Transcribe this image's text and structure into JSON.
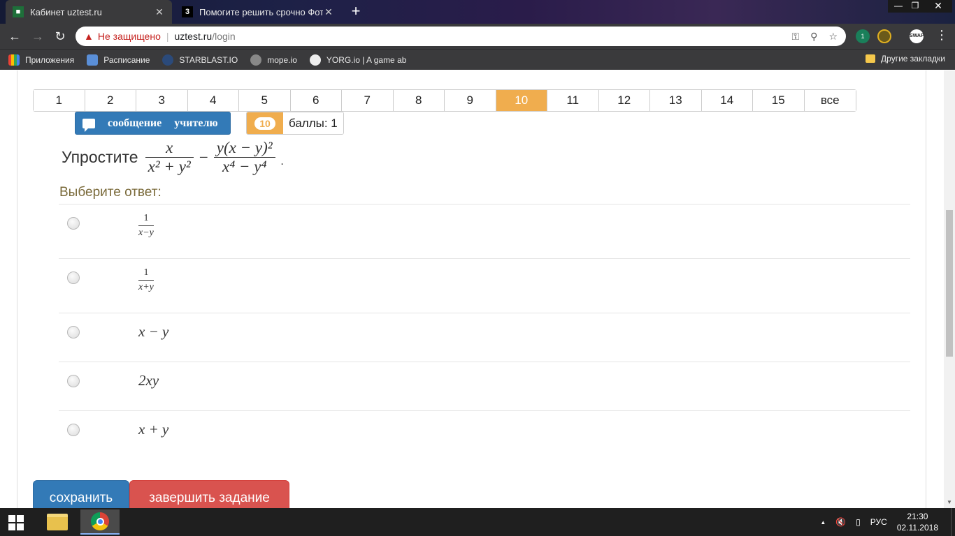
{
  "browser": {
    "tabs": [
      {
        "title": "Кабинет uztest.ru",
        "close": "✕",
        "active": true
      },
      {
        "title": "Помогите решить срочно Фото",
        "close": "✕",
        "active": false
      }
    ],
    "new_tab": "+",
    "window": {
      "minimize": "—",
      "maximize": "❐",
      "close": "✕"
    },
    "nav": {
      "back": "←",
      "forward": "→",
      "reload": "↻"
    },
    "address": {
      "warning_icon": "▲",
      "security_text": "Не защищено",
      "separator": "|",
      "host": "uztest.ru",
      "path": "/login"
    },
    "omnibox_icons": {
      "key": "⚿",
      "zoom": "⚲",
      "star": "☆"
    },
    "extensions": {
      "badge_count": "1",
      "swap": "SWAP"
    },
    "menu": "⋮",
    "bookmarks": [
      {
        "label": "Приложения"
      },
      {
        "label": "Расписание"
      },
      {
        "label": "STARBLAST.IO"
      },
      {
        "label": "mope.io"
      },
      {
        "label": "YORG.io | A game ab"
      }
    ],
    "other_bookmarks": "Другие закладки"
  },
  "page": {
    "question_nav": [
      "1",
      "2",
      "3",
      "4",
      "5",
      "6",
      "7",
      "8",
      "9",
      "10",
      "11",
      "12",
      "13",
      "14",
      "15",
      "все"
    ],
    "active_question": "10",
    "message_button": "сообщение учителю",
    "score": {
      "number": "10",
      "label": "баллы: 1"
    },
    "question": {
      "lead": "Упростите",
      "f1_num": "x",
      "f1_den": "x² + y²",
      "minus": "−",
      "f2_num": "y(x − y)²",
      "f2_den": "x⁴ − y⁴",
      "end": "."
    },
    "choose_label": "Выберите ответ:",
    "answers": [
      {
        "type": "frac",
        "num": "1",
        "den": "x−y"
      },
      {
        "type": "frac",
        "num": "1",
        "den": "x+y"
      },
      {
        "type": "expr",
        "text": "x − y"
      },
      {
        "type": "expr",
        "text": "2xy"
      },
      {
        "type": "expr",
        "text": "x + y"
      }
    ],
    "save_button": "сохранить",
    "finish_button": "завершить задание",
    "colors": {
      "active": "#f0ad4e",
      "primary": "#337ab7",
      "danger": "#d9534f"
    }
  },
  "taskbar": {
    "language": "РУС",
    "time": "21:30",
    "date": "02.11.2018",
    "tray_chevron": "▲"
  }
}
